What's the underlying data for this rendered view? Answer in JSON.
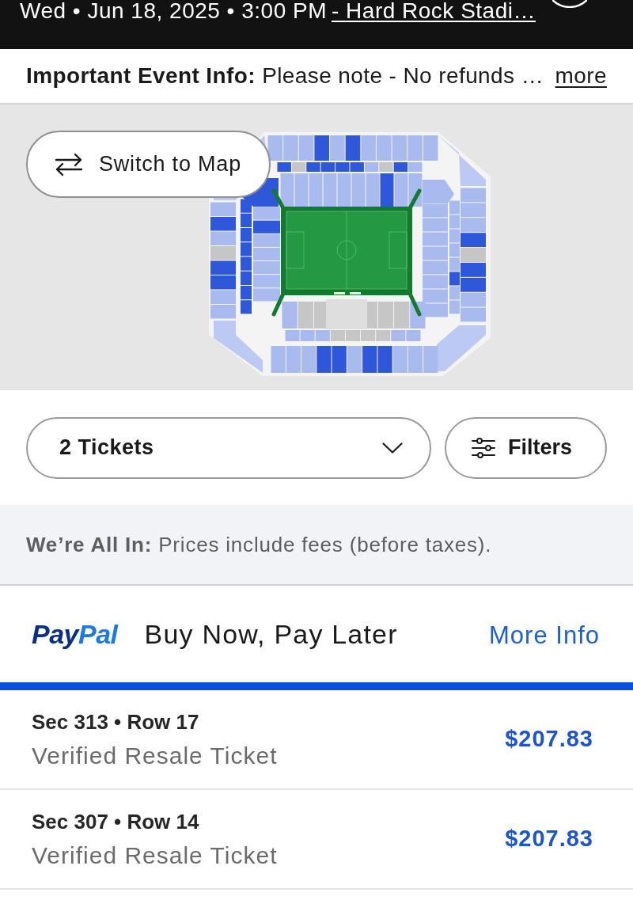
{
  "header": {
    "event_datetime": "Wed • Jun 18, 2025 • 3:00 PM",
    "venue_link": " - Hard Rock Stadi…"
  },
  "event_info": {
    "text": "**Important Event Info:** Please note - No refunds …",
    "more_link": "more"
  },
  "map": {
    "switch_button": "Switch to Map"
  },
  "controls": {
    "quantity_select": {
      "value": "2 Tickets"
    },
    "filters_button": "Filters"
  },
  "fees_notice": "**We’re All In:** Prices include fees (before taxes).",
  "paypal_banner": {
    "logo": [
      "Pay",
      "Pal"
    ],
    "text": "Buy Now, Pay Later",
    "link": "More Info"
  },
  "listings": [
    {
      "section_row": "Sec 313 • Row 17",
      "ticket_type": "Verified Resale Ticket",
      "price": "$207.83"
    },
    {
      "section_row": "Sec 307 • Row 14",
      "ticket_type": "Verified Resale Ticket",
      "price": "$207.83"
    }
  ]
}
